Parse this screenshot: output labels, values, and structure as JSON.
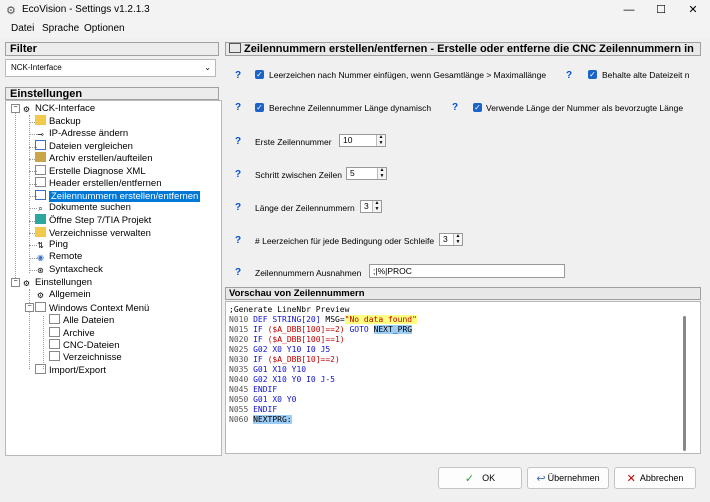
{
  "window": {
    "title": "EcoVision - Settings v1.2.1.3",
    "min": "—",
    "max": "☐",
    "close": "✕"
  },
  "menu": [
    "Datei",
    "Sprache",
    "Optionen"
  ],
  "filter": {
    "header": "Filter",
    "value": "NCK-Interface"
  },
  "tree": {
    "header": "Einstellungen",
    "items": [
      {
        "label": "NCK-Interface",
        "icon": "gear-icon"
      },
      {
        "label": "Backup",
        "icon": "folder-icon"
      },
      {
        "label": "IP-Adresse ändern",
        "icon": "network-icon"
      },
      {
        "label": "Dateien vergleichen",
        "icon": "document-icon"
      },
      {
        "label": "Archiv erstellen/aufteilen",
        "icon": "archive-icon"
      },
      {
        "label": "Erstelle Diagnose XML",
        "icon": "xml-icon"
      },
      {
        "label": "Header erstellen/entfernen",
        "icon": "header-icon"
      },
      {
        "label": "Zeilennummern erstellen/entfernen",
        "icon": "numbers-icon"
      },
      {
        "label": "Dokumente suchen",
        "icon": "search-icon"
      },
      {
        "label": "Öffne Step 7/TIA Projekt",
        "icon": "project-icon"
      },
      {
        "label": "Verzeichnisse verwalten",
        "icon": "folder-icon"
      },
      {
        "label": "Ping",
        "icon": "ping-icon"
      },
      {
        "label": "Remote",
        "icon": "remote-icon"
      },
      {
        "label": "Syntaxcheck",
        "icon": "check-icon"
      },
      {
        "label": "Einstellungen",
        "icon": "gear-icon"
      },
      {
        "label": "Allgemein",
        "icon": "gear-icon"
      },
      {
        "label": "Windows Context Menü",
        "icon": "menu-icon"
      },
      {
        "label": "Alle Dateien",
        "icon": "window-icon"
      },
      {
        "label": "Archive",
        "icon": "window-icon"
      },
      {
        "label": "CNC-Dateien",
        "icon": "window-icon"
      },
      {
        "label": "Verzeichnisse",
        "icon": "window-icon"
      },
      {
        "label": "Import/Export",
        "icon": "import-icon"
      }
    ]
  },
  "main": {
    "header": "Zeilennummern erstellen/entfernen - Erstelle oder entferne die CNC Zeilennummern in",
    "q": "?",
    "check": "✓",
    "options": {
      "opt1": "Leerzeichen nach Nummer einfügen, wenn Gesamtlänge > Maximallänge",
      "opt2": "Behalte alte Dateizeit n",
      "opt3": "Berechne Zeilennummer Länge dynamisch",
      "opt4": "Verwende Länge der Nummer als bevorzugte Länge"
    },
    "fields": {
      "first_label": "Erste Zeilennummer",
      "first_value": "10",
      "step_label": "Schritt zwischen Zeilen",
      "step_value": "5",
      "len_label": "Länge der Zeilennummern",
      "len_value": "3",
      "spaces_label": "# Leerzeichen für jede Bedingung oder Schleife",
      "spaces_value": "3",
      "excl_label": "Zeilennummern Ausnahmen",
      "excl_value": ";|%|PROC"
    }
  },
  "preview": {
    "header": "Vorschau von Zeilennummern",
    "lines": {
      "l0": ";Generate LineNbr Preview",
      "n1": "N010",
      "n2": "N015",
      "n3": "N020",
      "n4": "N025",
      "n5": "N030",
      "n6": "N035",
      "n7": "N040",
      "n8": "N045",
      "n9": "N050",
      "n10": "N055",
      "n11": "N060",
      "def": "DEF",
      "string": "STRING[20]",
      "msg": "MSG=",
      "msgstr": "\"No data found\"",
      "if": "IF",
      "a": "($A_DBB[100]==2)",
      "goto": "GOTO",
      "nextprg": "NEXT_PRG",
      "a2": "($A_DBB[100]==1)",
      "g02a": "G02 X0 Y10 I0 J5",
      "a3": "($A_DBB[10]==2)",
      "g01a": "G01 X10 Y10",
      "g02b": "G02 X10 Y0 I0 J-5",
      "endif": "ENDIF",
      "g01b": "G01 X0 Y0",
      "nextprgLabel": "NEXTPRG:"
    }
  },
  "buttons": {
    "ok": "OK",
    "apply": "Übernehmen",
    "cancel": "Abbrechen",
    "ok_icon": "✓",
    "apply_icon": "↩",
    "cancel_icon": "✕"
  }
}
